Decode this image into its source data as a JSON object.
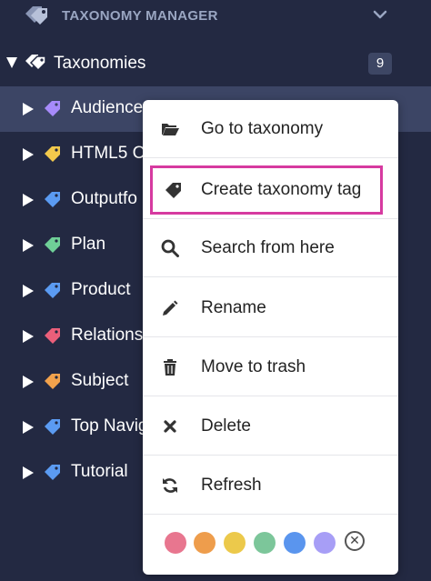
{
  "header": {
    "title": "TAXONOMY MANAGER",
    "logo_icon": "tags-icon",
    "collapse_icon": "chevron-down-icon"
  },
  "tree": {
    "root": {
      "label": "Taxonomies",
      "count": "9",
      "expanded": true
    },
    "items": [
      {
        "label": "Audience",
        "color": "#a78bfa",
        "selected": true
      },
      {
        "label": "HTML5 C",
        "color": "#f2c94c",
        "selected": false
      },
      {
        "label": "Outputfo",
        "color": "#5b9bf2",
        "selected": false
      },
      {
        "label": "Plan",
        "color": "#6fcf97",
        "selected": false
      },
      {
        "label": "Product",
        "color": "#5b9bf2",
        "selected": false
      },
      {
        "label": "Relations",
        "color": "#eb5f7a",
        "selected": false
      },
      {
        "label": "Subject",
        "color": "#f2a24c",
        "selected": false
      },
      {
        "label": "Top Navig",
        "color": "#5b9bf2",
        "selected": false
      },
      {
        "label": "Tutorial",
        "color": "#5b9bf2",
        "selected": false
      }
    ]
  },
  "menu": {
    "items": [
      {
        "label": "Go to taxonomy",
        "icon": "folder-open-icon"
      },
      {
        "label": "Create taxonomy tag",
        "icon": "tag-icon",
        "highlighted": true
      },
      {
        "label": "Search from here",
        "icon": "search-icon"
      },
      {
        "label": "Rename",
        "icon": "pencil-icon"
      },
      {
        "label": "Move to trash",
        "icon": "trash-icon"
      },
      {
        "label": "Delete",
        "icon": "close-icon"
      },
      {
        "label": "Refresh",
        "icon": "refresh-icon"
      }
    ],
    "swatches": [
      "#e8768f",
      "#ee9d4c",
      "#ecc94b",
      "#7cc69a",
      "#5a95ee",
      "#a79ef6"
    ],
    "clear_label": "✕",
    "highlight_color": "#d63aa0"
  }
}
